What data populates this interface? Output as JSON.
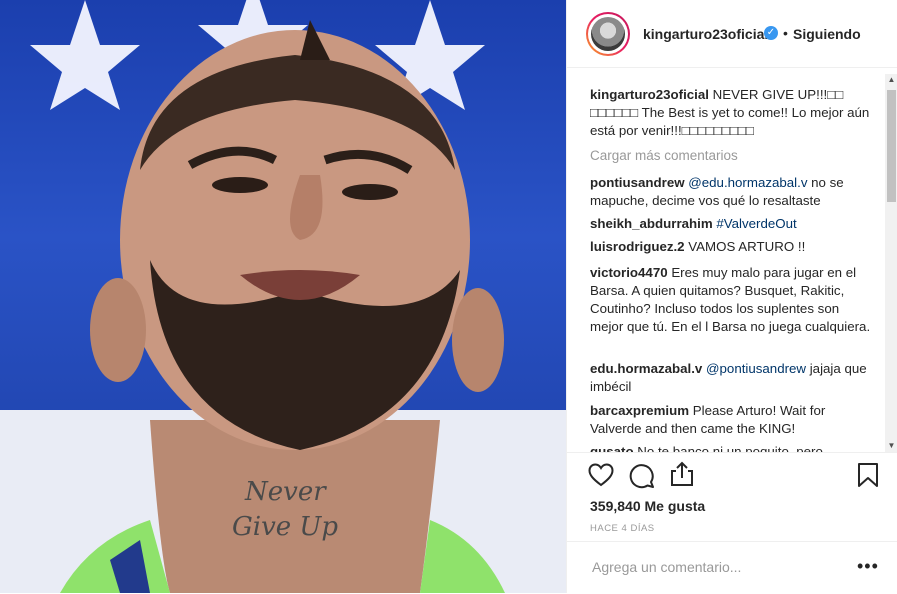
{
  "post": {
    "username": "kingarturo23oficial",
    "follow_status": "Siguiendo",
    "separator": "•"
  },
  "caption": {
    "username": "kingarturo23oficial",
    "text": "NEVER GIVE UP!!!□□ □□□□□□ The Best is yet to come!! Lo mejor aún está por venir!!!□□□□□□□□□"
  },
  "load_more": "Cargar más comentarios",
  "comments": [
    {
      "user": "pontiusandrew",
      "mention": "@edu.hormazabal.v",
      "text": " no se mapuche, decime vos qué lo resaltaste"
    },
    {
      "user": "sheikh_abdurrahim",
      "mention": "#ValverdeOut",
      "text": ""
    },
    {
      "user": "luisrodriguez.2",
      "mention": "",
      "text": "VAMOS ARTURO !!"
    },
    {
      "user": "victorio4470",
      "mention": "",
      "text": "Eres muy malo para jugar en el Barsa. A quien quitamos? Busquet, Rakitic, Coutinho? Incluso todos los suplentes son mejor que tú. En el l Barsa no juega cualquiera."
    },
    {
      "user": "edu.hormazabal.v",
      "mention": "@pontiusandrew",
      "text": " jajaja que imbécil"
    },
    {
      "user": "barcaxpremium",
      "mention": "",
      "text": "Please Arturo! Wait for Valverde and then came the KING!"
    },
    {
      "user": "gusato",
      "mention": "",
      "text": "No te banco ni un poquito, pero"
    }
  ],
  "likes": "359,840 Me gusta",
  "timestamp": "HACE 4 DÍAS",
  "comment_input": {
    "placeholder": "Agrega un comentario..."
  },
  "more_label": "•••",
  "photo_tattoo_text": [
    "Never",
    "Give Up"
  ],
  "icons": {
    "like": "heart-icon",
    "comment": "comment-bubble-icon",
    "share": "share-icon",
    "save": "bookmark-icon",
    "verified": "verified-badge-icon"
  }
}
